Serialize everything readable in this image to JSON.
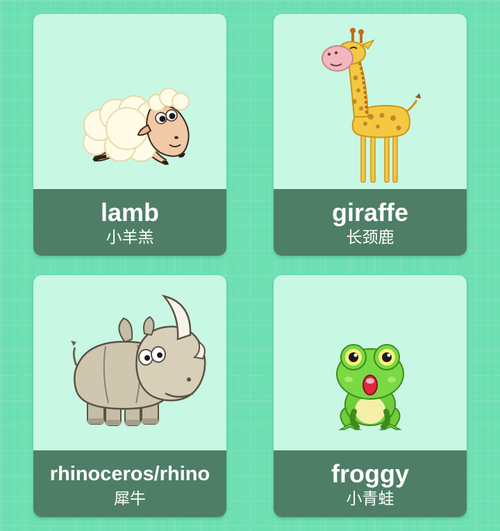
{
  "cards": [
    {
      "english": "lamb",
      "chinese": "小羊羔",
      "icon": "lamb-icon"
    },
    {
      "english": "giraffe",
      "chinese": "长颈鹿",
      "icon": "giraffe-icon"
    },
    {
      "english": "rhinoceros/rhino",
      "chinese": "犀牛",
      "icon": "rhino-icon"
    },
    {
      "english": "froggy",
      "chinese": "小青蛙",
      "icon": "frog-icon"
    }
  ],
  "colors": {
    "background": "#6fe0b4",
    "card": "#c8f7e3",
    "label_bar": "#4e7e66",
    "text": "#ffffff"
  }
}
